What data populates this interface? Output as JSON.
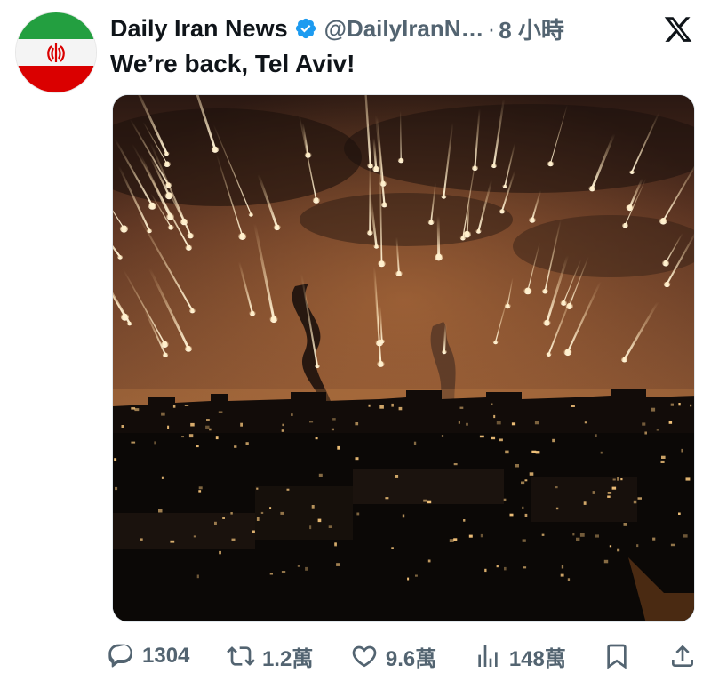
{
  "author": {
    "name": "Daily Iran News",
    "handle": "@DailyIranN…",
    "separator": "·",
    "time": "8 小時",
    "verified": true,
    "avatar_icon": "iran-flag-avatar"
  },
  "tweet": {
    "text": "We’re back, Tel Aviv!",
    "media_icon": "night-city-missile-barrage-photo"
  },
  "actions": {
    "replies": "1304",
    "retweets": "1.2萬",
    "likes": "9.6萬",
    "views": "148萬",
    "bookmark_icon": "bookmark-icon",
    "share_icon": "share-icon"
  },
  "colors": {
    "text": "#0f1419",
    "muted": "#536471",
    "verified_blue": "#1d9bf0",
    "flag_green": "#239f40",
    "flag_red": "#da0000"
  }
}
